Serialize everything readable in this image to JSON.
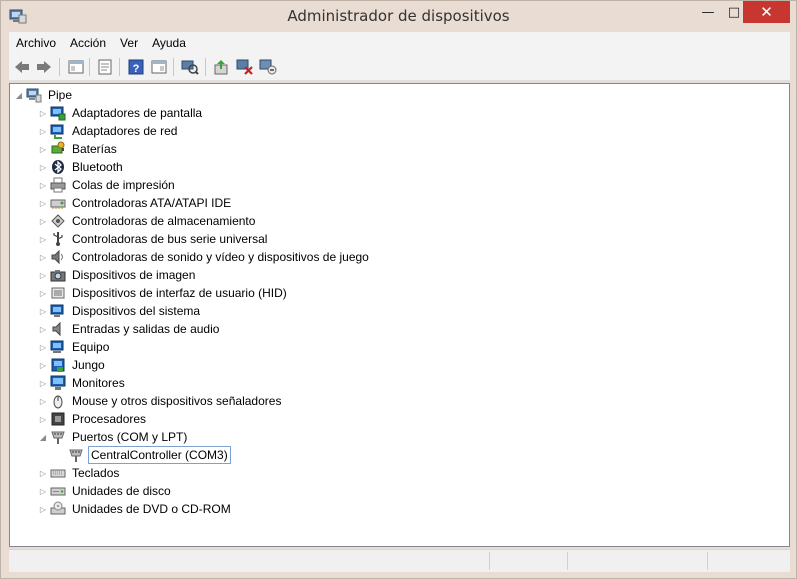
{
  "window": {
    "title": "Administrador de dispositivos",
    "minimize_glyph": "—",
    "maximize_glyph": "□",
    "close_glyph": "✕"
  },
  "menu": [
    "Archivo",
    "Acción",
    "Ver",
    "Ayuda"
  ],
  "toolbar": {
    "buttons": [
      "back-arrow-icon",
      "forward-arrow-icon",
      "show-hide-tree-icon",
      "properties-icon",
      "help-icon",
      "action-pane-icon",
      "scan-hardware-icon",
      "update-driver-icon",
      "disable-device-icon",
      "uninstall-device-icon"
    ]
  },
  "tree": {
    "root": "Pipe",
    "categories": [
      {
        "label": "Adaptadores de pantalla",
        "icon": "display-adapter-icon",
        "expanded": false
      },
      {
        "label": "Adaptadores de red",
        "icon": "network-adapter-icon",
        "expanded": false
      },
      {
        "label": "Baterías",
        "icon": "battery-icon",
        "expanded": false
      },
      {
        "label": "Bluetooth",
        "icon": "bluetooth-icon",
        "expanded": false
      },
      {
        "label": "Colas de impresión",
        "icon": "printer-icon",
        "expanded": false
      },
      {
        "label": "Controladoras ATA/ATAPI IDE",
        "icon": "ide-controller-icon",
        "expanded": false
      },
      {
        "label": "Controladoras de almacenamiento",
        "icon": "storage-controller-icon",
        "expanded": false
      },
      {
        "label": "Controladoras de bus serie universal",
        "icon": "usb-icon",
        "expanded": false
      },
      {
        "label": "Controladoras de sonido y vídeo y dispositivos de juego",
        "icon": "speaker-icon",
        "expanded": false
      },
      {
        "label": "Dispositivos de imagen",
        "icon": "camera-icon",
        "expanded": false
      },
      {
        "label": "Dispositivos de interfaz de usuario (HID)",
        "icon": "hid-icon",
        "expanded": false
      },
      {
        "label": "Dispositivos del sistema",
        "icon": "system-device-icon",
        "expanded": false
      },
      {
        "label": "Entradas y salidas de audio",
        "icon": "audio-io-icon",
        "expanded": false
      },
      {
        "label": "Equipo",
        "icon": "computer-icon",
        "expanded": false
      },
      {
        "label": "Jungo",
        "icon": "jungo-icon",
        "expanded": false
      },
      {
        "label": "Monitores",
        "icon": "monitor-icon",
        "expanded": false
      },
      {
        "label": "Mouse y otros dispositivos señaladores",
        "icon": "mouse-icon",
        "expanded": false
      },
      {
        "label": "Procesadores",
        "icon": "processor-icon",
        "expanded": false
      },
      {
        "label": "Puertos (COM y LPT)",
        "icon": "port-icon",
        "expanded": true
      },
      {
        "label": "CentralController (COM3)",
        "icon": "port-icon",
        "child": true,
        "selected": true
      },
      {
        "label": "Teclados",
        "icon": "keyboard-icon",
        "expanded": false
      },
      {
        "label": "Unidades de disco",
        "icon": "disk-drive-icon",
        "expanded": false
      },
      {
        "label": "Unidades de DVD o CD-ROM",
        "icon": "dvd-drive-icon",
        "expanded": false
      }
    ]
  },
  "colors": {
    "frame": "#e9dcd2",
    "close_button": "#c7362f",
    "selection_border": "#7da2ce",
    "tree_border": "#828790"
  }
}
